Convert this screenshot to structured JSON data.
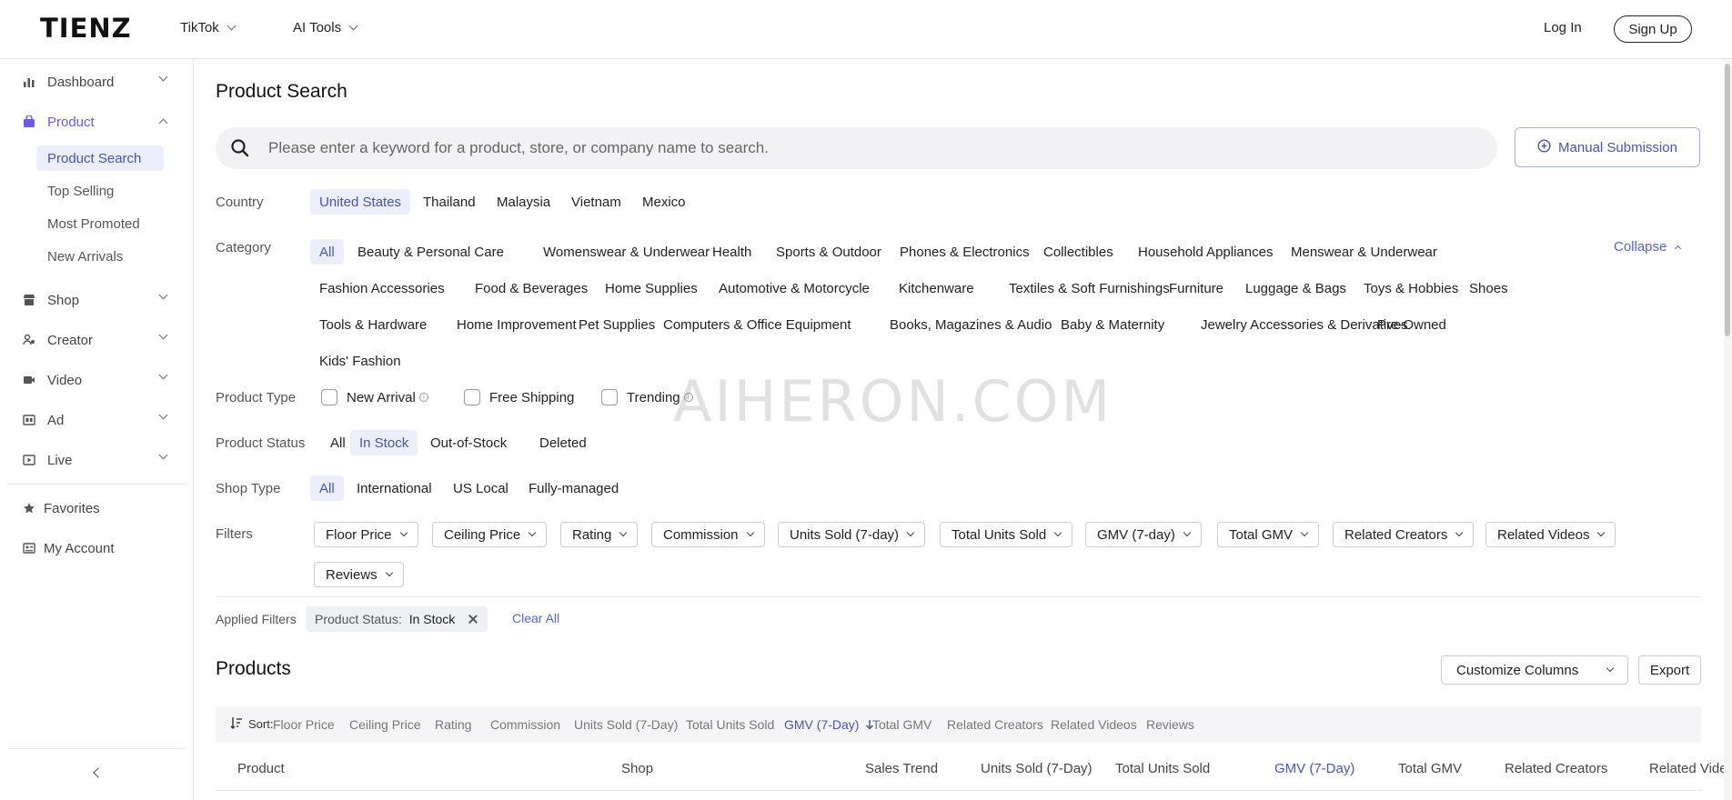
{
  "header": {
    "logo": "TIENZ",
    "nav": [
      {
        "label": "TikTok"
      },
      {
        "label": "AI Tools"
      }
    ],
    "login": "Log In",
    "signup": "Sign Up"
  },
  "sidebar": {
    "items": [
      {
        "label": "Dashboard",
        "icon": "bar-chart-icon"
      },
      {
        "label": "Product",
        "icon": "bag-icon",
        "active": true
      },
      {
        "label": "Shop",
        "icon": "shop-icon"
      },
      {
        "label": "Creator",
        "icon": "creator-icon"
      },
      {
        "label": "Video",
        "icon": "video-icon"
      },
      {
        "label": "Ad",
        "icon": "ad-icon"
      },
      {
        "label": "Live",
        "icon": "live-icon"
      }
    ],
    "product_sub": [
      "Product Search",
      "Top Selling",
      "Most Promoted",
      "New Arrivals"
    ],
    "bottom": [
      {
        "label": "Favorites",
        "icon": "star-icon"
      },
      {
        "label": "My Account",
        "icon": "account-icon"
      }
    ]
  },
  "main": {
    "title": "Product Search",
    "search_placeholder": "Please enter a keyword for a product, store, or company name to search.",
    "manual_submission": "Manual Submission",
    "country": {
      "label": "Country",
      "options": [
        "United States",
        "Thailand",
        "Malaysia",
        "Vietnam",
        "Mexico"
      ],
      "selected": "United States"
    },
    "category": {
      "label": "Category",
      "collapse": "Collapse",
      "row1": [
        "All",
        "Beauty & Personal Care",
        "Womenswear & Underwear",
        "Health",
        "Sports & Outdoor",
        "Phones & Electronics",
        "Collectibles",
        "Household Appliances",
        "Menswear & Underwear"
      ],
      "row2": [
        "Fashion Accessories",
        "Food & Beverages",
        "Home Supplies",
        "Automotive & Motorcycle",
        "Kitchenware",
        "Textiles & Soft Furnishings",
        "Furniture",
        "Luggage & Bags",
        "Toys & Hobbies",
        "Shoes"
      ],
      "row3": [
        "Tools & Hardware",
        "Home Improvement",
        "Pet Supplies",
        "Computers & Office Equipment",
        "Books, Magazines & Audio",
        "Baby & Maternity",
        "Jewelry Accessories & Derivatives",
        "Pre-Owned"
      ],
      "row4": [
        "Kids' Fashion"
      ]
    },
    "product_type": {
      "label": "Product Type",
      "options": [
        "New Arrival",
        "Free Shipping",
        "Trending"
      ]
    },
    "product_status": {
      "label": "Product Status",
      "options": [
        "All",
        "In Stock",
        "Out-of-Stock",
        "Deleted"
      ]
    },
    "shop_type": {
      "label": "Shop Type",
      "options": [
        "All",
        "International",
        "US Local",
        "Fully-managed"
      ]
    },
    "filters": {
      "label": "Filters",
      "dropdowns": [
        "Floor Price",
        "Ceiling Price",
        "Rating",
        "Commission",
        "Units Sold (7-day)",
        "Total Units Sold",
        "GMV (7-day)",
        "Total GMV",
        "Related Creators",
        "Related Videos",
        "Reviews"
      ]
    },
    "applied": {
      "label": "Applied Filters",
      "tag_key": "Product Status:",
      "tag_value": "In Stock",
      "clear_all": "Clear All"
    },
    "products": {
      "title": "Products",
      "customize": "Customize Columns",
      "export": "Export",
      "sort_label": "Sort:",
      "sort_options": [
        "Floor Price",
        "Ceiling Price",
        "Rating",
        "Commission",
        "Units Sold (7-Day)",
        "Total Units Sold",
        "GMV (7-Day)",
        "Total GMV",
        "Related Creators",
        "Related Videos",
        "Reviews"
      ],
      "columns": [
        "Product",
        "Shop",
        "Sales Trend",
        "Units Sold (7-Day)",
        "Total Units Sold",
        "GMV (7-Day)",
        "Total GMV",
        "Related Creators",
        "Related Videos"
      ]
    }
  },
  "watermark": "AIHERON.COM",
  "colors": {
    "accent": "#4a55a8",
    "active_bg": "#eceefb",
    "product_icon": "#6c5ce7"
  }
}
